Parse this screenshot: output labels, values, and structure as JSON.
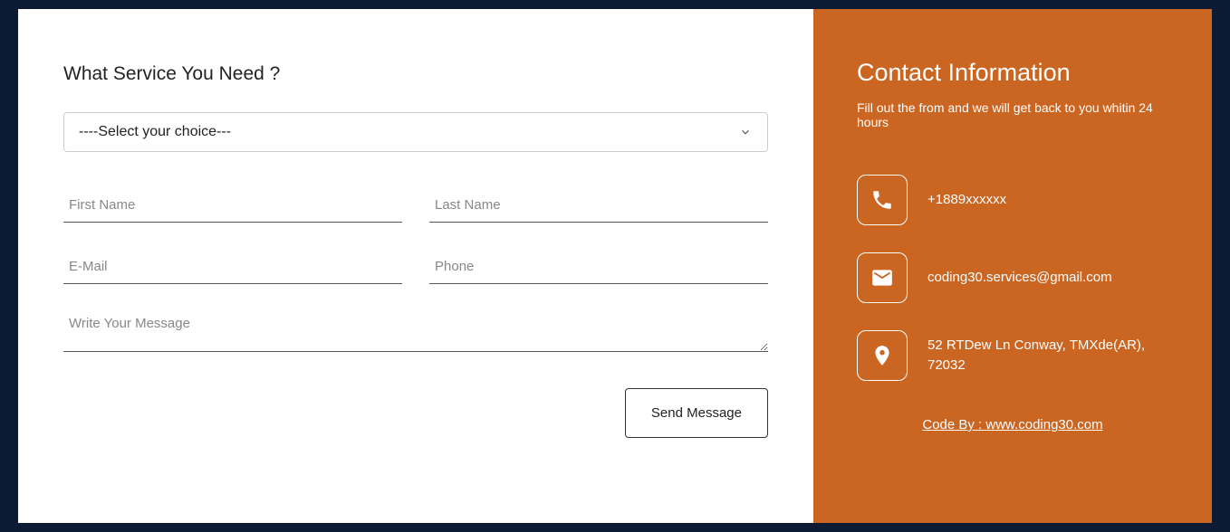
{
  "form": {
    "title": "What Service You Need ?",
    "select_placeholder": "----Select your choice---",
    "first_name_placeholder": "First Name",
    "last_name_placeholder": "Last Name",
    "email_placeholder": "E-Mail",
    "phone_placeholder": "Phone",
    "message_placeholder": "Write Your Message",
    "send_button": "Send Message"
  },
  "info": {
    "title": "Contact Information",
    "subtitle": "Fill out the from and we will get back to you whitin 24 hours",
    "phone": "+1889xxxxxx",
    "email": "coding30.services@gmail.com",
    "address": "52 RTDew Ln Conway, TMXde(AR), 72032",
    "link_text": "Code By : www.coding30.com"
  }
}
